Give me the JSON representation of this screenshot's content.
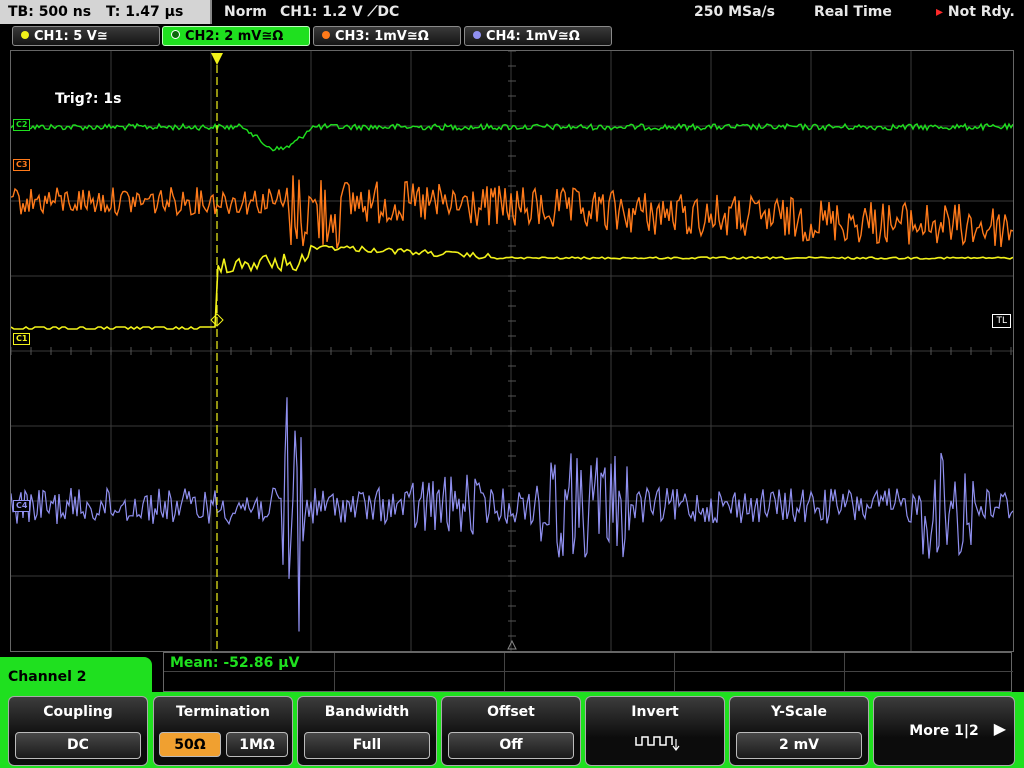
{
  "topbar": {
    "timebase": "TB: 500 ns",
    "trigger_time": "T: 1.47 µs",
    "mode": "Norm",
    "trigger_setting": "CH1: 1.2 V",
    "trigger_coupling": "DC",
    "sample_rate": "250 MSa/s",
    "acq_mode": "Real Time",
    "status": "Not Rdy."
  },
  "channels": [
    {
      "id": "ch1",
      "label": "CH1: 5 V≅",
      "color": "#f2f21a"
    },
    {
      "id": "ch2",
      "label": "CH2: 2 mV≅Ω",
      "color": "#1fe01f",
      "active": true
    },
    {
      "id": "ch3",
      "label": "CH3: 1mV≅Ω",
      "color": "#ff7a1a"
    },
    {
      "id": "ch4",
      "label": "CH4: 1mV≅Ω",
      "color": "#9090f0"
    }
  ],
  "screen": {
    "trigger_info": "Trig?: 1s",
    "tl_label": "TL",
    "markers": {
      "ch1": "C1",
      "ch2": "C2",
      "ch3": "C3",
      "ch4": "C4"
    }
  },
  "measurement": {
    "mean": "Mean: -52.86 µV"
  },
  "menu": {
    "title": "Channel 2",
    "softkeys": {
      "coupling": {
        "title": "Coupling",
        "value": "DC"
      },
      "termination": {
        "title": "Termination",
        "opt1": "50Ω",
        "opt2": "1MΩ",
        "selected": "50Ω"
      },
      "bandwidth": {
        "title": "Bandwidth",
        "value": "Full"
      },
      "offset": {
        "title": "Offset",
        "value": "Off"
      },
      "invert": {
        "title": "Invert"
      },
      "yscale": {
        "title": "Y-Scale",
        "value": "2 mV"
      },
      "more": {
        "title": "More 1|2"
      }
    }
  }
}
